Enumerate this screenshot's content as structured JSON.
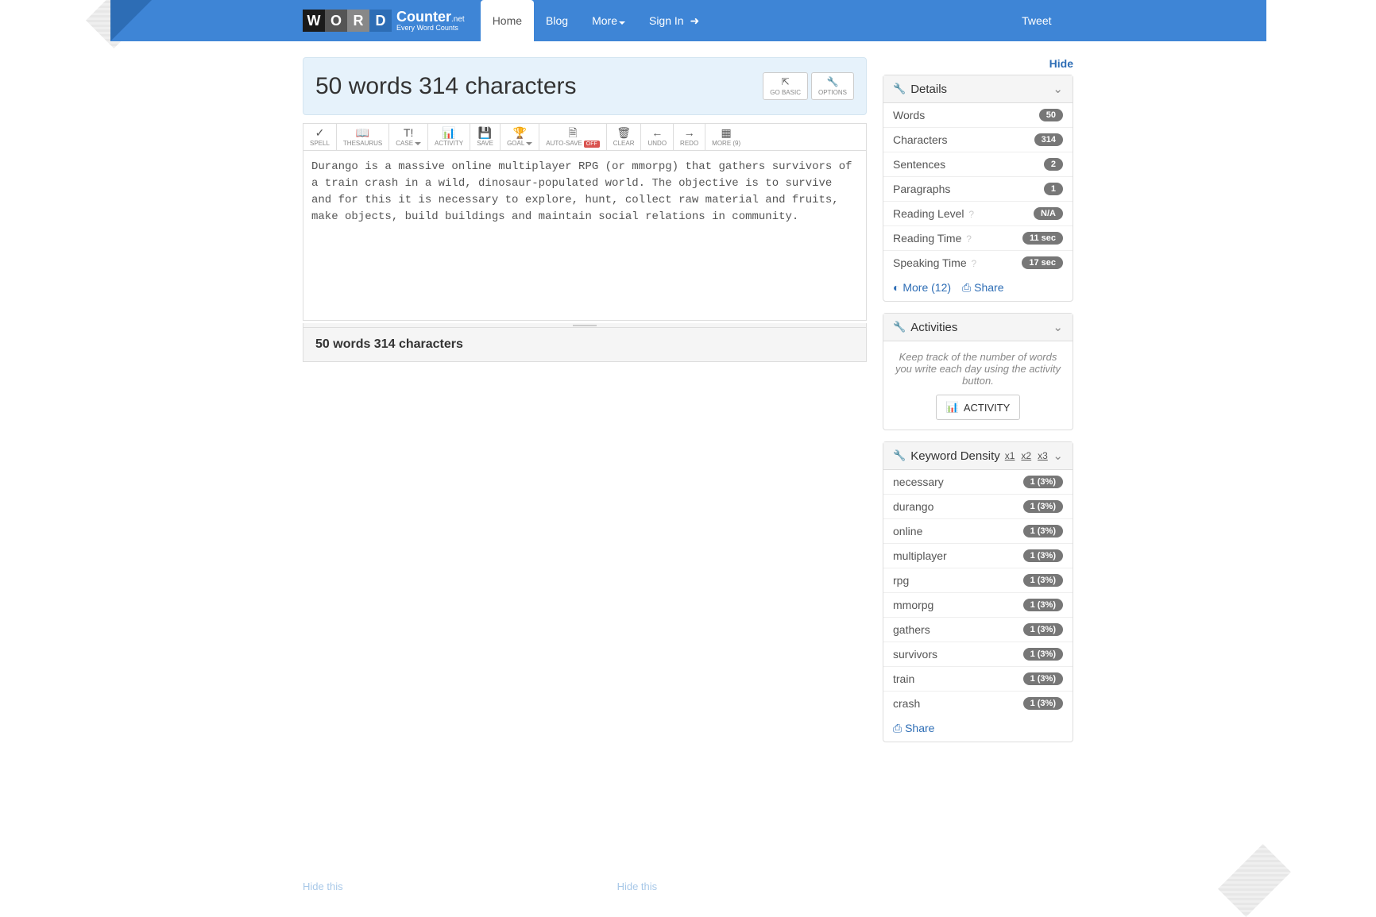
{
  "nav": {
    "logo_main": "Counter",
    "logo_net": ".net",
    "logo_sub": "Every Word Counts",
    "items": [
      "Home",
      "Blog",
      "More",
      "Sign In"
    ],
    "tweet": "Tweet"
  },
  "header": {
    "title": "50 words 314 characters",
    "go_basic": "GO BASIC",
    "options": "OPTIONS"
  },
  "toolbar": {
    "spell": "SPELL",
    "thesaurus": "THESAURUS",
    "case": "CASE",
    "activity": "ACTIVITY",
    "save": "SAVE",
    "goal": "GOAL",
    "autosave": "AUTO-SAVE",
    "autosave_off": "OFF",
    "clear": "CLEAR",
    "undo": "UNDO",
    "redo": "REDO",
    "more": "MORE (9)"
  },
  "editor": {
    "text": "Durango is a massive online multiplayer RPG (or mmorpg) that gathers survivors of a train crash in a wild, dinosaur-populated world. The objective is to survive and for this it is necessary to explore, hunt, collect raw material and fruits, make objects, build buildings and maintain social relations in community."
  },
  "footer": {
    "summary": "50 words 314 characters"
  },
  "side": {
    "hide": "Hide",
    "details": {
      "title": "Details",
      "rows": [
        {
          "label": "Words",
          "value": "50"
        },
        {
          "label": "Characters",
          "value": "314"
        },
        {
          "label": "Sentences",
          "value": "2"
        },
        {
          "label": "Paragraphs",
          "value": "1"
        },
        {
          "label": "Reading Level",
          "value": "N/A",
          "help": true
        },
        {
          "label": "Reading Time",
          "value": "11 sec",
          "help": true
        },
        {
          "label": "Speaking Time",
          "value": "17 sec",
          "help": true
        }
      ],
      "more": "More (12)",
      "share": "Share"
    },
    "activities": {
      "title": "Activities",
      "desc": "Keep track of the number of words you write each day using the activity button.",
      "btn": "ACTIVITY"
    },
    "keyword": {
      "title": "Keyword Density",
      "mults": [
        "x1",
        "x2",
        "x3"
      ],
      "rows": [
        {
          "label": "necessary",
          "value": "1 (3%)"
        },
        {
          "label": "durango",
          "value": "1 (3%)"
        },
        {
          "label": "online",
          "value": "1 (3%)"
        },
        {
          "label": "multiplayer",
          "value": "1 (3%)"
        },
        {
          "label": "rpg",
          "value": "1 (3%)"
        },
        {
          "label": "mmorpg",
          "value": "1 (3%)"
        },
        {
          "label": "gathers",
          "value": "1 (3%)"
        },
        {
          "label": "survivors",
          "value": "1 (3%)"
        },
        {
          "label": "train",
          "value": "1 (3%)"
        },
        {
          "label": "crash",
          "value": "1 (3%)"
        }
      ],
      "share": "Share"
    }
  },
  "bottom": {
    "hide_this": "Hide this"
  }
}
